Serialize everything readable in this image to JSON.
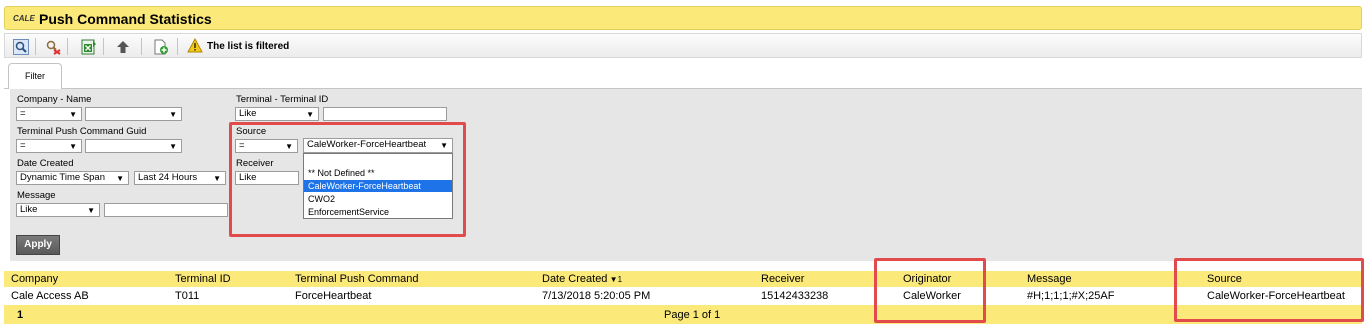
{
  "app": {
    "logo_text": "CALE",
    "title": "Push Command Statistics"
  },
  "toolbar": {
    "buttons": [
      "search-icon",
      "clear-filter-icon",
      "export-excel-icon",
      "upload-icon",
      "add-document-icon"
    ],
    "warning_text": "The list is filtered"
  },
  "tabs": [
    {
      "label": "Filter"
    }
  ],
  "filter": {
    "company_name": {
      "label": "Company - Name",
      "operator": "=",
      "value": ""
    },
    "guid": {
      "label": "Terminal Push Command Guid",
      "operator": "=",
      "value": ""
    },
    "date_created": {
      "label": "Date Created",
      "mode": "Dynamic Time Span",
      "value": "Last 24 Hours"
    },
    "message": {
      "label": "Message",
      "operator": "Like",
      "value": ""
    },
    "terminal_id": {
      "label": "Terminal - Terminal ID",
      "operator": "Like",
      "value": ""
    },
    "source": {
      "label": "Source",
      "operator": "=",
      "value": "CaleWorker-ForceHeartbeat"
    },
    "receiver": {
      "label": "Receiver",
      "operator": "Like"
    },
    "source_options": [
      "",
      "** Not Defined **",
      "CaleWorker-ForceHeartbeat",
      "CWO2",
      "EnforcementService"
    ],
    "apply_label": "Apply"
  },
  "grid": {
    "columns": [
      "Company",
      "Terminal ID",
      "Terminal Push Command",
      "Date Created",
      "Receiver",
      "Originator",
      "Message",
      "Source"
    ],
    "sort": {
      "column": "Date Created",
      "direction": "desc",
      "order": "1"
    },
    "rows": [
      {
        "company": "Cale Access AB",
        "terminal_id": "T011",
        "push_command": "ForceHeartbeat",
        "date_created": "7/13/2018 5:20:05 PM",
        "receiver": "15142433238",
        "originator": "CaleWorker",
        "message": "#H;1;1;1;#X;25AF",
        "source": "CaleWorker-ForceHeartbeat"
      }
    ],
    "footer": {
      "count": "1",
      "pager": "Page 1 of 1"
    }
  },
  "colors": {
    "header_yellow": "#fbe97a",
    "highlight_red": "#e24b4b",
    "selected_blue": "#1e73e8"
  }
}
